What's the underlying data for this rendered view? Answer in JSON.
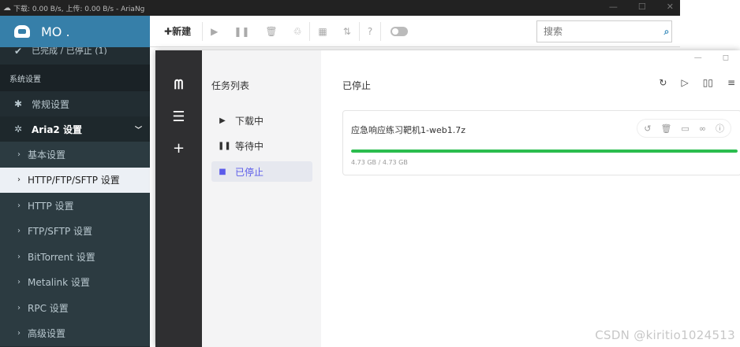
{
  "titlebar": {
    "text": "下载: 0.00 B/s, 上传: 0.00 B/s - AriaNg",
    "cloud_icon": "cloud-icon",
    "minimize": "—",
    "maximize": "☐",
    "close": "✕"
  },
  "sidebar": {
    "brand": "MO .",
    "cut_item": "已完成 / 已停止 (1)",
    "section_header": "系统设置",
    "general": "常规设置",
    "aria2": "Aria2 设置",
    "sub_items": [
      "基本设置",
      "HTTP/FTP/SFTP 设置",
      "HTTP 设置",
      "FTP/SFTP 设置",
      "BitTorrent 设置",
      "Metalink 设置",
      "RPC 设置",
      "高级设置"
    ]
  },
  "toolbar": {
    "new_label": "新建",
    "search_placeholder": "搜索"
  },
  "motrix": {
    "list_title": "任务列表",
    "list_items": [
      "下载中",
      "等待中",
      "已停止"
    ],
    "main_title": "已停止",
    "task": {
      "name": "应急响应练习靶机1-web1.7z",
      "size": "4.73 GB / 4.73 GB",
      "progress": 1.0
    }
  },
  "watermark": "CSDN @kiritio1024513",
  "colors": {
    "sidebar_bg": "#222d32",
    "brand_bg": "#367fa9",
    "progress": "#2bbd4e",
    "active_list": "#5b5bea"
  }
}
